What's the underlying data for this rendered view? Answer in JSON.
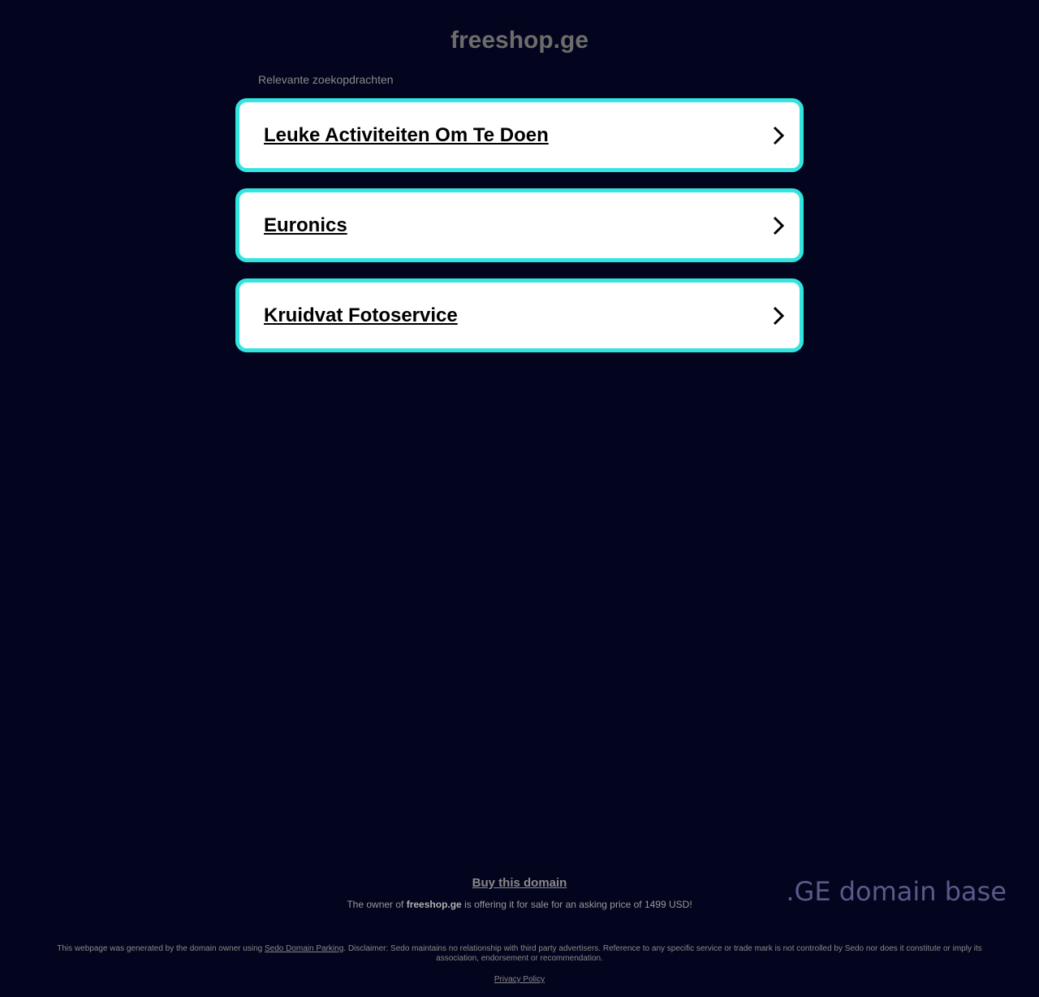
{
  "domain": "freeshop.ge",
  "related_label": "Relevante zoekopdrachten",
  "ads": [
    {
      "label": "Leuke Activiteiten Om Te Doen"
    },
    {
      "label": "Euronics"
    },
    {
      "label": "Kruidvat Fotoservice"
    }
  ],
  "sale": {
    "buy_label": "Buy this domain",
    "text_before": "The owner of ",
    "domain": "freeshop.ge",
    "text_after": " is offering it for sale for an asking price of 1499 USD!"
  },
  "logo_text": ".GE domain base",
  "footer": {
    "disclaimer_before": "This webpage was generated by the domain owner using ",
    "sedo_link": "Sedo Domain Parking",
    "disclaimer_after": ". Disclaimer: Sedo maintains no relationship with third party advertisers. Reference to any specific service or trade mark is not controlled by Sedo nor does it constitute or imply its association, endorsement or recommendation.",
    "privacy": "Privacy Policy"
  },
  "colors": {
    "background": "#03041d",
    "ad_border": "#33e5e0",
    "ad_background": "#ffffff"
  },
  "icons": {
    "ad_arrow": "chevron-right-icon"
  }
}
